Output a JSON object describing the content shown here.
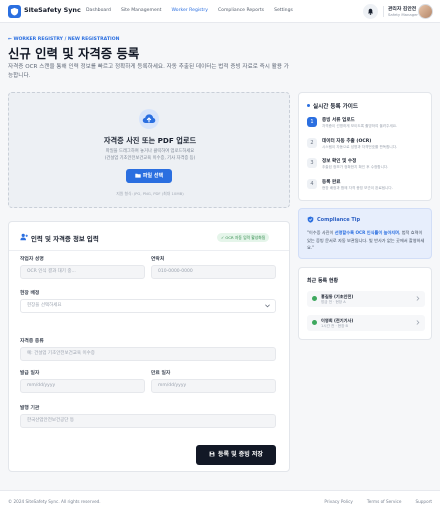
{
  "header": {
    "brand": "SiteSafety Sync",
    "nav": [
      "Dashboard",
      "Site Management",
      "Worker Registry",
      "Compliance Reports",
      "Settings"
    ],
    "active_nav": 2,
    "user_name": "관리자 김안전",
    "user_role": "Safety Manager"
  },
  "page": {
    "breadcrumb": "← WORKER REGISTRY / NEW REGISTRATION",
    "title": "신규 인력 및 자격증 등록",
    "description": "자격증 OCR 스캔을 통해 인력 정보를 빠르고 정확하게 등록하세요. 자동 추출된 데이터는 법적 증빙 자료로 즉시 활용 가능합니다."
  },
  "upload": {
    "title": "자격증 사진 또는 PDF 업로드",
    "hint_line1": "파일을 드래그하여 놓거나 클릭하여 업로드하세요",
    "hint_line2": "(건설업 기초안전보건교육 이수증, 기사 자격증 등)",
    "button": "파일 선택",
    "formats": "지원 형식: JPG, PNG, PDF (최대 10MB)"
  },
  "form": {
    "title": "인력 및 자격증 정보 입력",
    "badge": "✓ OCR 자동 입력 활성화됨",
    "name_label": "작업자 성명",
    "name_placeholder": "OCR 인식 결과 대기 중...",
    "phone_label": "연락처",
    "phone_placeholder": "010-0000-0000",
    "site_label": "현장 배정",
    "site_placeholder": "현장을 선택하세요",
    "cert_label": "자격증 종류",
    "cert_placeholder": "예: 건설업 기초안전보건교육 이수증",
    "issue_label": "발급 일자",
    "issue_placeholder": "mm/dd/yyyy",
    "expiry_label": "만료 일자",
    "expiry_placeholder": "mm/dd/yyyy",
    "issuer_label": "발행 기관",
    "issuer_placeholder": "한국산업안전보건공단 등",
    "submit": "등록 및 증빙 저장"
  },
  "guide": {
    "title": "실시간 등록 가이드",
    "steps": [
      {
        "num": "1",
        "title": "증빙 서류 업로드",
        "desc": "자격증이 선명하게 보이도록 촬영하여 올려주세요."
      },
      {
        "num": "2",
        "title": "데이터 자동 추출 (OCR)",
        "desc": "시스템이 자동으로 성명과 자격번호를 판독합니다."
      },
      {
        "num": "3",
        "title": "정보 확인 및 수정",
        "desc": "추출된 정보가 정확한지 확인 후 수정합니다."
      },
      {
        "num": "4",
        "title": "등록 완료",
        "desc": "현장 배정과 함께 자격 증빙 보관이 완료됩니다."
      }
    ]
  },
  "tip": {
    "title": "Compliance Tip",
    "text_before": "\"이수증 사진이 ",
    "text_bold": "선명할수록 OCR 인식률이 높아지며",
    "text_after": ", 법적 효력이 있는 증빙 문서로 자동 보관됩니다. 빛 반사가 없는 곳에서 촬영하세요.\""
  },
  "recent": {
    "title": "최근 등록 현황",
    "items": [
      {
        "name": "홍길동 (기초안전)",
        "sub": "방금 전 · 현장 A"
      },
      {
        "name": "이영희 (전기기사)",
        "sub": "1시간 전 · 현장 B"
      }
    ]
  },
  "footer": {
    "copyright": "© 2024 SiteSafety Sync. All rights reserved.",
    "links": [
      "Privacy Policy",
      "Terms of Service",
      "Support"
    ]
  }
}
